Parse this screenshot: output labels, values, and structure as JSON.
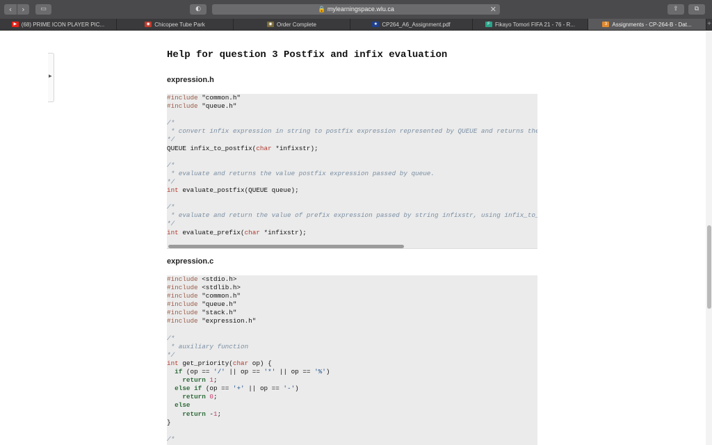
{
  "browser": {
    "back_icon": "‹",
    "forward_icon": "›",
    "url": "🔒 mylearningspace.wlu.ca",
    "close_glyph": "✕",
    "tabs": [
      {
        "label": "(68) PRIME ICON PLAYER PIC...",
        "icon": "youtube-icon",
        "color": "#e62117",
        "glyph": "▶",
        "active": false
      },
      {
        "label": "Chicopee Tube Park",
        "icon": "site-icon",
        "color": "#c0392b",
        "glyph": "◉",
        "active": false
      },
      {
        "label": "Order Complete",
        "icon": "site-icon",
        "color": "#7a6a3a",
        "glyph": "◉",
        "active": false
      },
      {
        "label": "CP264_A6_Assignment.pdf",
        "icon": "pdf-icon",
        "color": "#1e3f8c",
        "glyph": "★",
        "active": false
      },
      {
        "label": "Fikayo Tomori FIFA 21 - 76 - R...",
        "icon": "futbin-icon",
        "color": "#2aa38a",
        "glyph": "F",
        "active": false
      },
      {
        "label": "Assignments - CP-264-B - Dat...",
        "icon": "d2l-icon",
        "color": "#e08a2e",
        "glyph": "3",
        "active": true
      }
    ]
  },
  "page": {
    "title": "Help for question 3 Postfix and infix evaluation",
    "file1": "expression.h",
    "file2": "expression.c"
  }
}
